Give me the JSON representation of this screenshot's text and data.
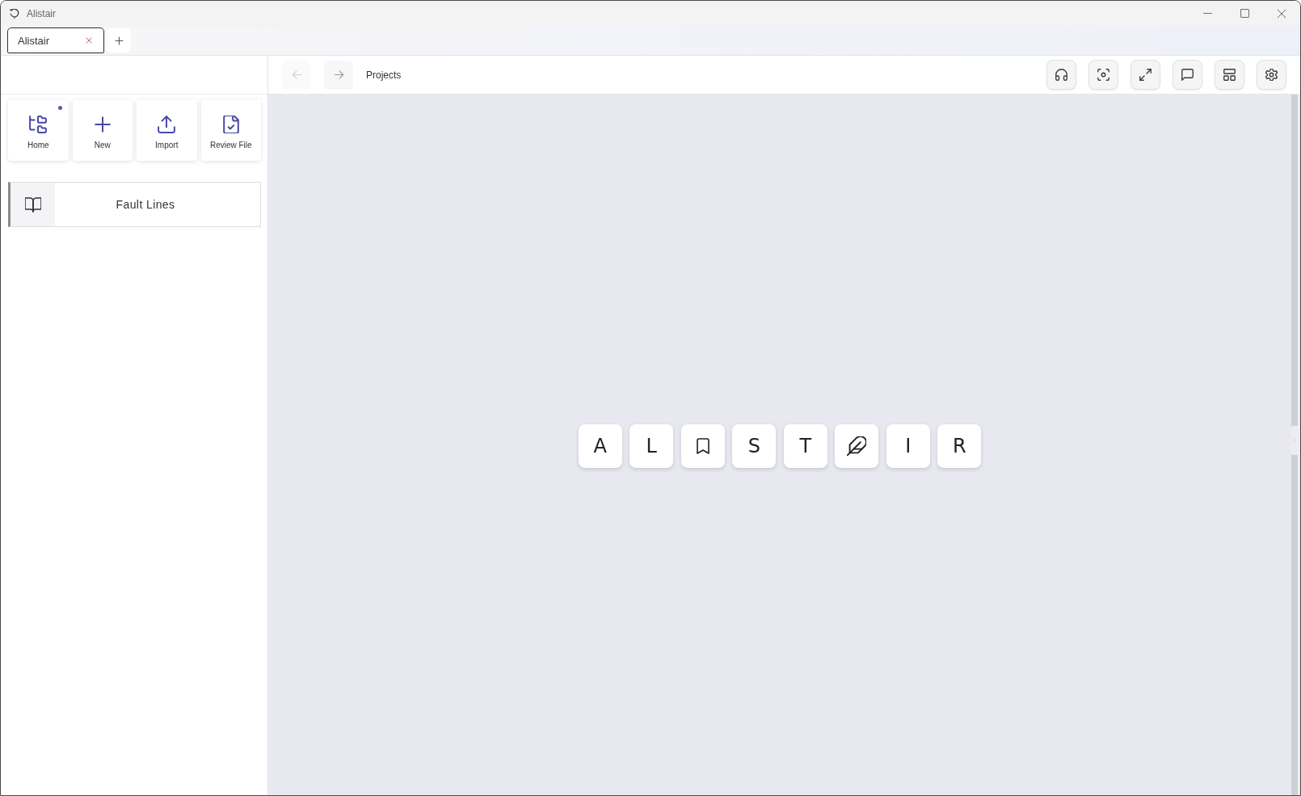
{
  "window": {
    "title": "Alistair"
  },
  "tabs": [
    {
      "label": "Alistair",
      "selected": true
    }
  ],
  "sidebar": {
    "quick_actions": [
      {
        "label": "Home",
        "badge": true
      },
      {
        "label": "New",
        "badge": false
      },
      {
        "label": "Import",
        "badge": false
      },
      {
        "label": "Review File",
        "badge": false
      }
    ],
    "items": [
      {
        "label": "Fault Lines",
        "selected": true
      }
    ]
  },
  "header": {
    "back": {
      "disabled": true
    },
    "forward": {
      "disabled": false
    },
    "breadcrumb": "Projects"
  },
  "logo_tiles": [
    {
      "kind": "letter",
      "text": "A"
    },
    {
      "kind": "letter",
      "text": "L"
    },
    {
      "kind": "bookmark"
    },
    {
      "kind": "letter",
      "text": "S"
    },
    {
      "kind": "letter",
      "text": "T"
    },
    {
      "kind": "feather"
    },
    {
      "kind": "letter",
      "text": "I"
    },
    {
      "kind": "letter",
      "text": "R"
    }
  ]
}
